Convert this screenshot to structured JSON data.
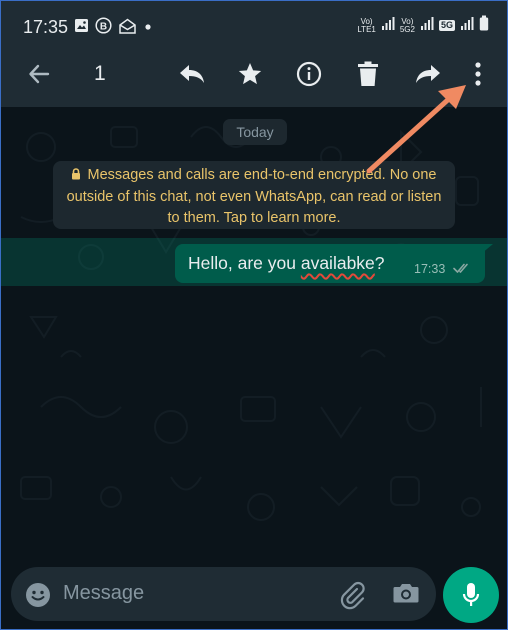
{
  "status_bar": {
    "time": "17:35",
    "notification_icons": [
      "gallery-icon",
      "b-badge-icon",
      "mail-open-icon",
      "dot-icon"
    ],
    "sim1_label_top": "Vo)",
    "sim1_label_bottom": "LTE1",
    "sim2_label_top": "Vo)",
    "sim2_label_bottom": "5G2",
    "network_badge": "5G"
  },
  "app_bar": {
    "selection_count": "1",
    "actions": [
      "back-arrow-icon",
      "reply-icon",
      "star-icon",
      "info-icon",
      "delete-icon",
      "forward-icon",
      "more-options-icon"
    ]
  },
  "chat": {
    "date_chip": "Today",
    "encryption_notice": "Messages and calls are end-to-end encrypted. No one outside of this chat, not even WhatsApp, can read or listen to them. Tap to learn more.",
    "message": {
      "text_before": "Hello, are you ",
      "misspelled_word": "availabke",
      "text_after": "?",
      "time": "17:33",
      "status": "delivered"
    }
  },
  "composer": {
    "placeholder": "Message"
  },
  "colors": {
    "background": "#0b141a",
    "bar": "#1f2c34",
    "accent": "#00a884",
    "outgoing_bubble": "#005c4b",
    "annotation_arrow": "#f08a62",
    "notice_text": "#e9c46a"
  }
}
